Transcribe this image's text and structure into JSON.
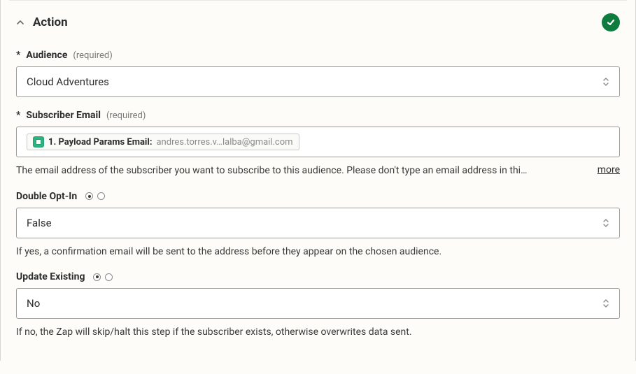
{
  "header": {
    "title": "Action"
  },
  "fields": {
    "audience": {
      "star": "*",
      "label": "Audience",
      "required": "(required)",
      "value": "Cloud Adventures"
    },
    "subscriber_email": {
      "star": "*",
      "label": "Subscriber Email",
      "required": "(required)",
      "pill_label": "1. Payload Params Email: ",
      "pill_value": "andres.torres.v…lalba@gmail.com",
      "help": "The email address of the subscriber you want to subscribe to this audience. Please don't type an email address in thi…",
      "more": "more"
    },
    "double_opt_in": {
      "label": "Double Opt-In",
      "value": "False",
      "help": "If yes, a confirmation email will be sent to the address before they appear on the chosen audience."
    },
    "update_existing": {
      "label": "Update Existing",
      "value": "No",
      "help": "If no, the Zap will skip/halt this step if the subscriber exists, otherwise overwrites data sent."
    }
  }
}
